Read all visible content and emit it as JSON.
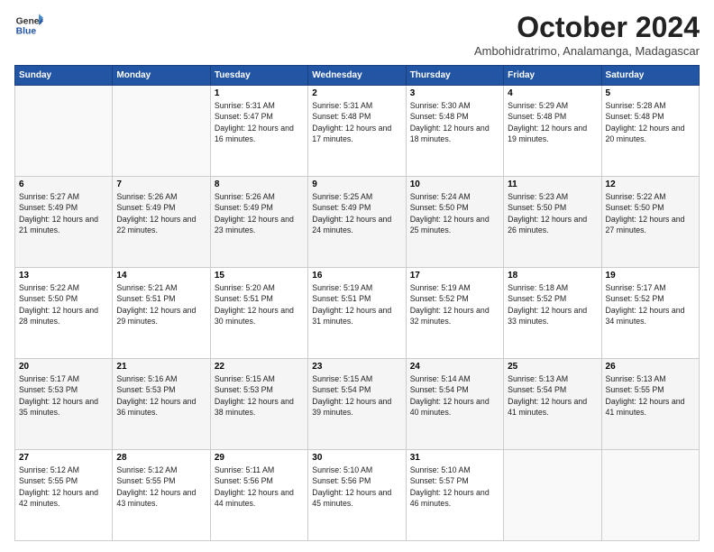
{
  "logo": {
    "line1": "General",
    "line2": "Blue"
  },
  "header": {
    "title": "October 2024",
    "subtitle": "Ambohidratrimo, Analamanga, Madagascar"
  },
  "weekdays": [
    "Sunday",
    "Monday",
    "Tuesday",
    "Wednesday",
    "Thursday",
    "Friday",
    "Saturday"
  ],
  "weeks": [
    [
      {
        "day": "",
        "sunrise": "",
        "sunset": "",
        "daylight": ""
      },
      {
        "day": "",
        "sunrise": "",
        "sunset": "",
        "daylight": ""
      },
      {
        "day": "1",
        "sunrise": "Sunrise: 5:31 AM",
        "sunset": "Sunset: 5:47 PM",
        "daylight": "Daylight: 12 hours and 16 minutes."
      },
      {
        "day": "2",
        "sunrise": "Sunrise: 5:31 AM",
        "sunset": "Sunset: 5:48 PM",
        "daylight": "Daylight: 12 hours and 17 minutes."
      },
      {
        "day": "3",
        "sunrise": "Sunrise: 5:30 AM",
        "sunset": "Sunset: 5:48 PM",
        "daylight": "Daylight: 12 hours and 18 minutes."
      },
      {
        "day": "4",
        "sunrise": "Sunrise: 5:29 AM",
        "sunset": "Sunset: 5:48 PM",
        "daylight": "Daylight: 12 hours and 19 minutes."
      },
      {
        "day": "5",
        "sunrise": "Sunrise: 5:28 AM",
        "sunset": "Sunset: 5:48 PM",
        "daylight": "Daylight: 12 hours and 20 minutes."
      }
    ],
    [
      {
        "day": "6",
        "sunrise": "Sunrise: 5:27 AM",
        "sunset": "Sunset: 5:49 PM",
        "daylight": "Daylight: 12 hours and 21 minutes."
      },
      {
        "day": "7",
        "sunrise": "Sunrise: 5:26 AM",
        "sunset": "Sunset: 5:49 PM",
        "daylight": "Daylight: 12 hours and 22 minutes."
      },
      {
        "day": "8",
        "sunrise": "Sunrise: 5:26 AM",
        "sunset": "Sunset: 5:49 PM",
        "daylight": "Daylight: 12 hours and 23 minutes."
      },
      {
        "day": "9",
        "sunrise": "Sunrise: 5:25 AM",
        "sunset": "Sunset: 5:49 PM",
        "daylight": "Daylight: 12 hours and 24 minutes."
      },
      {
        "day": "10",
        "sunrise": "Sunrise: 5:24 AM",
        "sunset": "Sunset: 5:50 PM",
        "daylight": "Daylight: 12 hours and 25 minutes."
      },
      {
        "day": "11",
        "sunrise": "Sunrise: 5:23 AM",
        "sunset": "Sunset: 5:50 PM",
        "daylight": "Daylight: 12 hours and 26 minutes."
      },
      {
        "day": "12",
        "sunrise": "Sunrise: 5:22 AM",
        "sunset": "Sunset: 5:50 PM",
        "daylight": "Daylight: 12 hours and 27 minutes."
      }
    ],
    [
      {
        "day": "13",
        "sunrise": "Sunrise: 5:22 AM",
        "sunset": "Sunset: 5:50 PM",
        "daylight": "Daylight: 12 hours and 28 minutes."
      },
      {
        "day": "14",
        "sunrise": "Sunrise: 5:21 AM",
        "sunset": "Sunset: 5:51 PM",
        "daylight": "Daylight: 12 hours and 29 minutes."
      },
      {
        "day": "15",
        "sunrise": "Sunrise: 5:20 AM",
        "sunset": "Sunset: 5:51 PM",
        "daylight": "Daylight: 12 hours and 30 minutes."
      },
      {
        "day": "16",
        "sunrise": "Sunrise: 5:19 AM",
        "sunset": "Sunset: 5:51 PM",
        "daylight": "Daylight: 12 hours and 31 minutes."
      },
      {
        "day": "17",
        "sunrise": "Sunrise: 5:19 AM",
        "sunset": "Sunset: 5:52 PM",
        "daylight": "Daylight: 12 hours and 32 minutes."
      },
      {
        "day": "18",
        "sunrise": "Sunrise: 5:18 AM",
        "sunset": "Sunset: 5:52 PM",
        "daylight": "Daylight: 12 hours and 33 minutes."
      },
      {
        "day": "19",
        "sunrise": "Sunrise: 5:17 AM",
        "sunset": "Sunset: 5:52 PM",
        "daylight": "Daylight: 12 hours and 34 minutes."
      }
    ],
    [
      {
        "day": "20",
        "sunrise": "Sunrise: 5:17 AM",
        "sunset": "Sunset: 5:53 PM",
        "daylight": "Daylight: 12 hours and 35 minutes."
      },
      {
        "day": "21",
        "sunrise": "Sunrise: 5:16 AM",
        "sunset": "Sunset: 5:53 PM",
        "daylight": "Daylight: 12 hours and 36 minutes."
      },
      {
        "day": "22",
        "sunrise": "Sunrise: 5:15 AM",
        "sunset": "Sunset: 5:53 PM",
        "daylight": "Daylight: 12 hours and 38 minutes."
      },
      {
        "day": "23",
        "sunrise": "Sunrise: 5:15 AM",
        "sunset": "Sunset: 5:54 PM",
        "daylight": "Daylight: 12 hours and 39 minutes."
      },
      {
        "day": "24",
        "sunrise": "Sunrise: 5:14 AM",
        "sunset": "Sunset: 5:54 PM",
        "daylight": "Daylight: 12 hours and 40 minutes."
      },
      {
        "day": "25",
        "sunrise": "Sunrise: 5:13 AM",
        "sunset": "Sunset: 5:54 PM",
        "daylight": "Daylight: 12 hours and 41 minutes."
      },
      {
        "day": "26",
        "sunrise": "Sunrise: 5:13 AM",
        "sunset": "Sunset: 5:55 PM",
        "daylight": "Daylight: 12 hours and 41 minutes."
      }
    ],
    [
      {
        "day": "27",
        "sunrise": "Sunrise: 5:12 AM",
        "sunset": "Sunset: 5:55 PM",
        "daylight": "Daylight: 12 hours and 42 minutes."
      },
      {
        "day": "28",
        "sunrise": "Sunrise: 5:12 AM",
        "sunset": "Sunset: 5:55 PM",
        "daylight": "Daylight: 12 hours and 43 minutes."
      },
      {
        "day": "29",
        "sunrise": "Sunrise: 5:11 AM",
        "sunset": "Sunset: 5:56 PM",
        "daylight": "Daylight: 12 hours and 44 minutes."
      },
      {
        "day": "30",
        "sunrise": "Sunrise: 5:10 AM",
        "sunset": "Sunset: 5:56 PM",
        "daylight": "Daylight: 12 hours and 45 minutes."
      },
      {
        "day": "31",
        "sunrise": "Sunrise: 5:10 AM",
        "sunset": "Sunset: 5:57 PM",
        "daylight": "Daylight: 12 hours and 46 minutes."
      },
      {
        "day": "",
        "sunrise": "",
        "sunset": "",
        "daylight": ""
      },
      {
        "day": "",
        "sunrise": "",
        "sunset": "",
        "daylight": ""
      }
    ]
  ]
}
